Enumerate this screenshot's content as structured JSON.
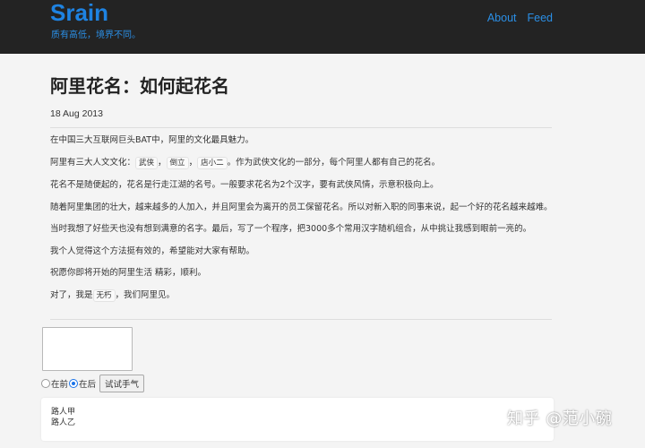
{
  "header": {
    "brand": "Srain",
    "tagline": "质有高低，境界不同。",
    "nav": {
      "about": "About",
      "feed": "Feed"
    }
  },
  "post": {
    "title": "阿里花名：如何起花名",
    "date": "18 Aug 2013",
    "p1": "在中国三大互联网巨头BAT中，阿里的文化最具魅力。",
    "p2": {
      "before": "阿里有三大人文文化：",
      "code1": "武侠",
      "sep1": "，",
      "code2": "倒立",
      "sep2": "，",
      "code3": "店小二",
      "after": "。作为武侠文化的一部分，每个阿里人都有自己的花名。"
    },
    "p3": "花名不是随便起的，花名是行走江湖的名号。一般要求花名为2个汉字，要有武侠风情，示意积极向上。",
    "p4": "随着阿里集团的壮大，越来越多的人加入，并且阿里会为离开的员工保留花名。所以对新入职的同事来说，起一个好的花名越来越难。",
    "p5": "当时我想了好些天也没有想到满意的名字。最后，写了一个程序，把3000多个常用汉字随机组合，从中挑让我感到眼前一亮的。",
    "p6": "我个人觉得这个方法挺有效的，希望能对大家有帮助。",
    "p7": "祝愿你即将开始的阿里生活 精彩，顺利。",
    "p8": {
      "before": "对了，我是",
      "code": "无朽",
      "after": "，我们阿里见。"
    }
  },
  "form": {
    "textarea_value": "",
    "option_before": "在前",
    "option_after": "在后",
    "selected": "在后",
    "button": "试试手气"
  },
  "results": [
    "路人甲",
    "路人乙"
  ],
  "watermark": "知乎 @范小碗",
  "colors": {
    "header_bg": "#232323",
    "brand": "#1e83e2",
    "link": "#2b8fe6",
    "page_bg": "#f4f4f4"
  }
}
